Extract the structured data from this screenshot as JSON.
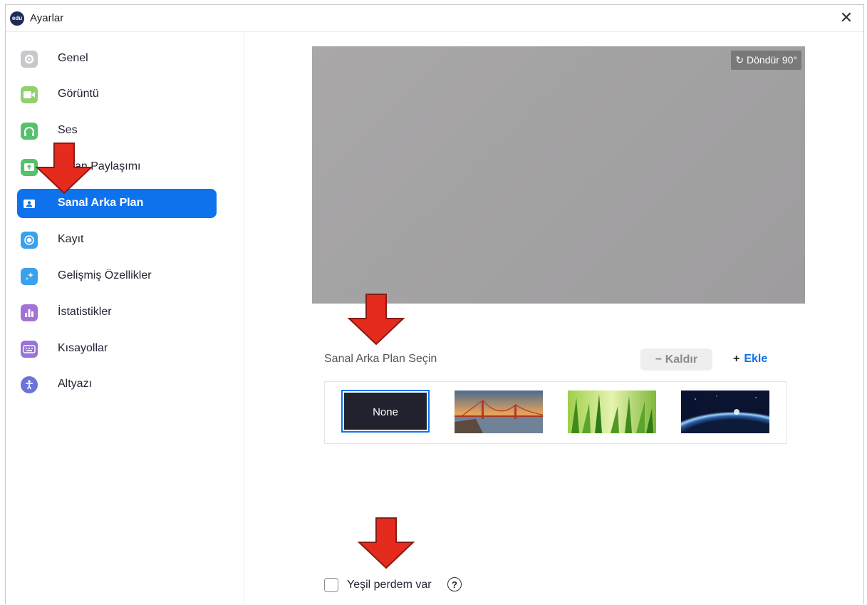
{
  "window": {
    "title": "Ayarlar",
    "close_glyph": "✕"
  },
  "sidebar": {
    "items": [
      {
        "label": "Genel",
        "icon": "gear-icon",
        "color": "#c7c7cc",
        "active": false
      },
      {
        "label": "Görüntü",
        "icon": "video-camera-icon",
        "color": "#8fd16f",
        "active": false
      },
      {
        "label": "Ses",
        "icon": "headphones-icon",
        "color": "#57c06d",
        "active": false
      },
      {
        "label": "Ekran Paylaşımı",
        "icon": "share-screen-icon",
        "color": "#57c06d",
        "active": false
      },
      {
        "label": "Sanal Arka Plan",
        "icon": "virtual-background-icon",
        "color": "#0e72ed",
        "active": true
      },
      {
        "label": "Kayıt",
        "icon": "record-icon",
        "color": "#3aa2ed",
        "active": false
      },
      {
        "label": "Gelişmiş Özellikler",
        "icon": "advanced-features-icon",
        "color": "#3aa2ed",
        "active": false
      },
      {
        "label": "İstatistikler",
        "icon": "statistics-icon",
        "color": "#a472d6",
        "active": false
      },
      {
        "label": "Kısayollar",
        "icon": "keyboard-icon",
        "color": "#9873d8",
        "active": false
      },
      {
        "label": "Altyazı",
        "icon": "accessibility-icon",
        "color": "#6b74d6",
        "active": false
      }
    ]
  },
  "main": {
    "rotate_label": "Döndür 90°",
    "choose_label": "Sanal Arka Plan Seçin",
    "remove_label": "Kaldır",
    "add_label": "Ekle",
    "backgrounds": [
      {
        "label": "None",
        "icon": "none-background",
        "selected": true
      },
      {
        "icon": "golden-gate-bridge-image",
        "selected": false
      },
      {
        "icon": "grass-image",
        "selected": false
      },
      {
        "icon": "earth-from-space-image",
        "selected": false
      }
    ],
    "green_screen_label": "Yeşil perdem var",
    "green_screen_checked": false
  },
  "annotation_color": "#e52a1e",
  "accent_color": "#0e72ed"
}
